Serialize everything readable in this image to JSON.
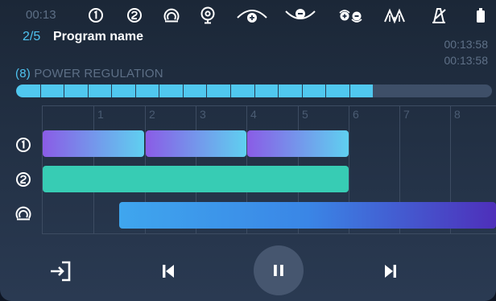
{
  "status_bar": {
    "elapsed": "00:13",
    "icons": [
      "zone-1-icon",
      "zone-2-icon",
      "zone-3-icon",
      "probe-icon",
      "temperature-up-icon",
      "temperature-down-icon",
      "temperature-adjust-icon",
      "wave-icon",
      "metronome-icon",
      "battery-icon"
    ]
  },
  "program": {
    "index": "2/5",
    "name": "Program name",
    "time_total": "00:13:58",
    "time_remaining": "00:13:58"
  },
  "power_regulation": {
    "index": "(8)",
    "label": "POWER REGULATION",
    "filled_segments": 15,
    "total_segments": 20
  },
  "timeline": {
    "columns": [
      "1",
      "2",
      "3",
      "4",
      "5",
      "6",
      "7",
      "8"
    ],
    "rows": [
      {
        "icon": "zone-1-icon",
        "segments": [
          [
            0,
            1
          ],
          [
            1,
            2
          ],
          [
            2,
            3
          ]
        ],
        "style": "purple"
      },
      {
        "icon": "zone-2-icon",
        "segments": [
          [
            0,
            3
          ]
        ],
        "style": "green"
      },
      {
        "icon": "zone-3-icon",
        "segments": [
          [
            0.75,
            4.5
          ]
        ],
        "style": "blue"
      }
    ]
  },
  "controls": {
    "exit": "exit-icon",
    "previous": "previous-icon",
    "pause": "pause-icon",
    "next": "next-icon"
  },
  "colors": {
    "accent": "#4fc3f0",
    "power_fill": "#50c8ef",
    "green_bar": "#37ccb4",
    "purple_start": "#8a5ce6",
    "blue_end": "#4e2fba"
  }
}
